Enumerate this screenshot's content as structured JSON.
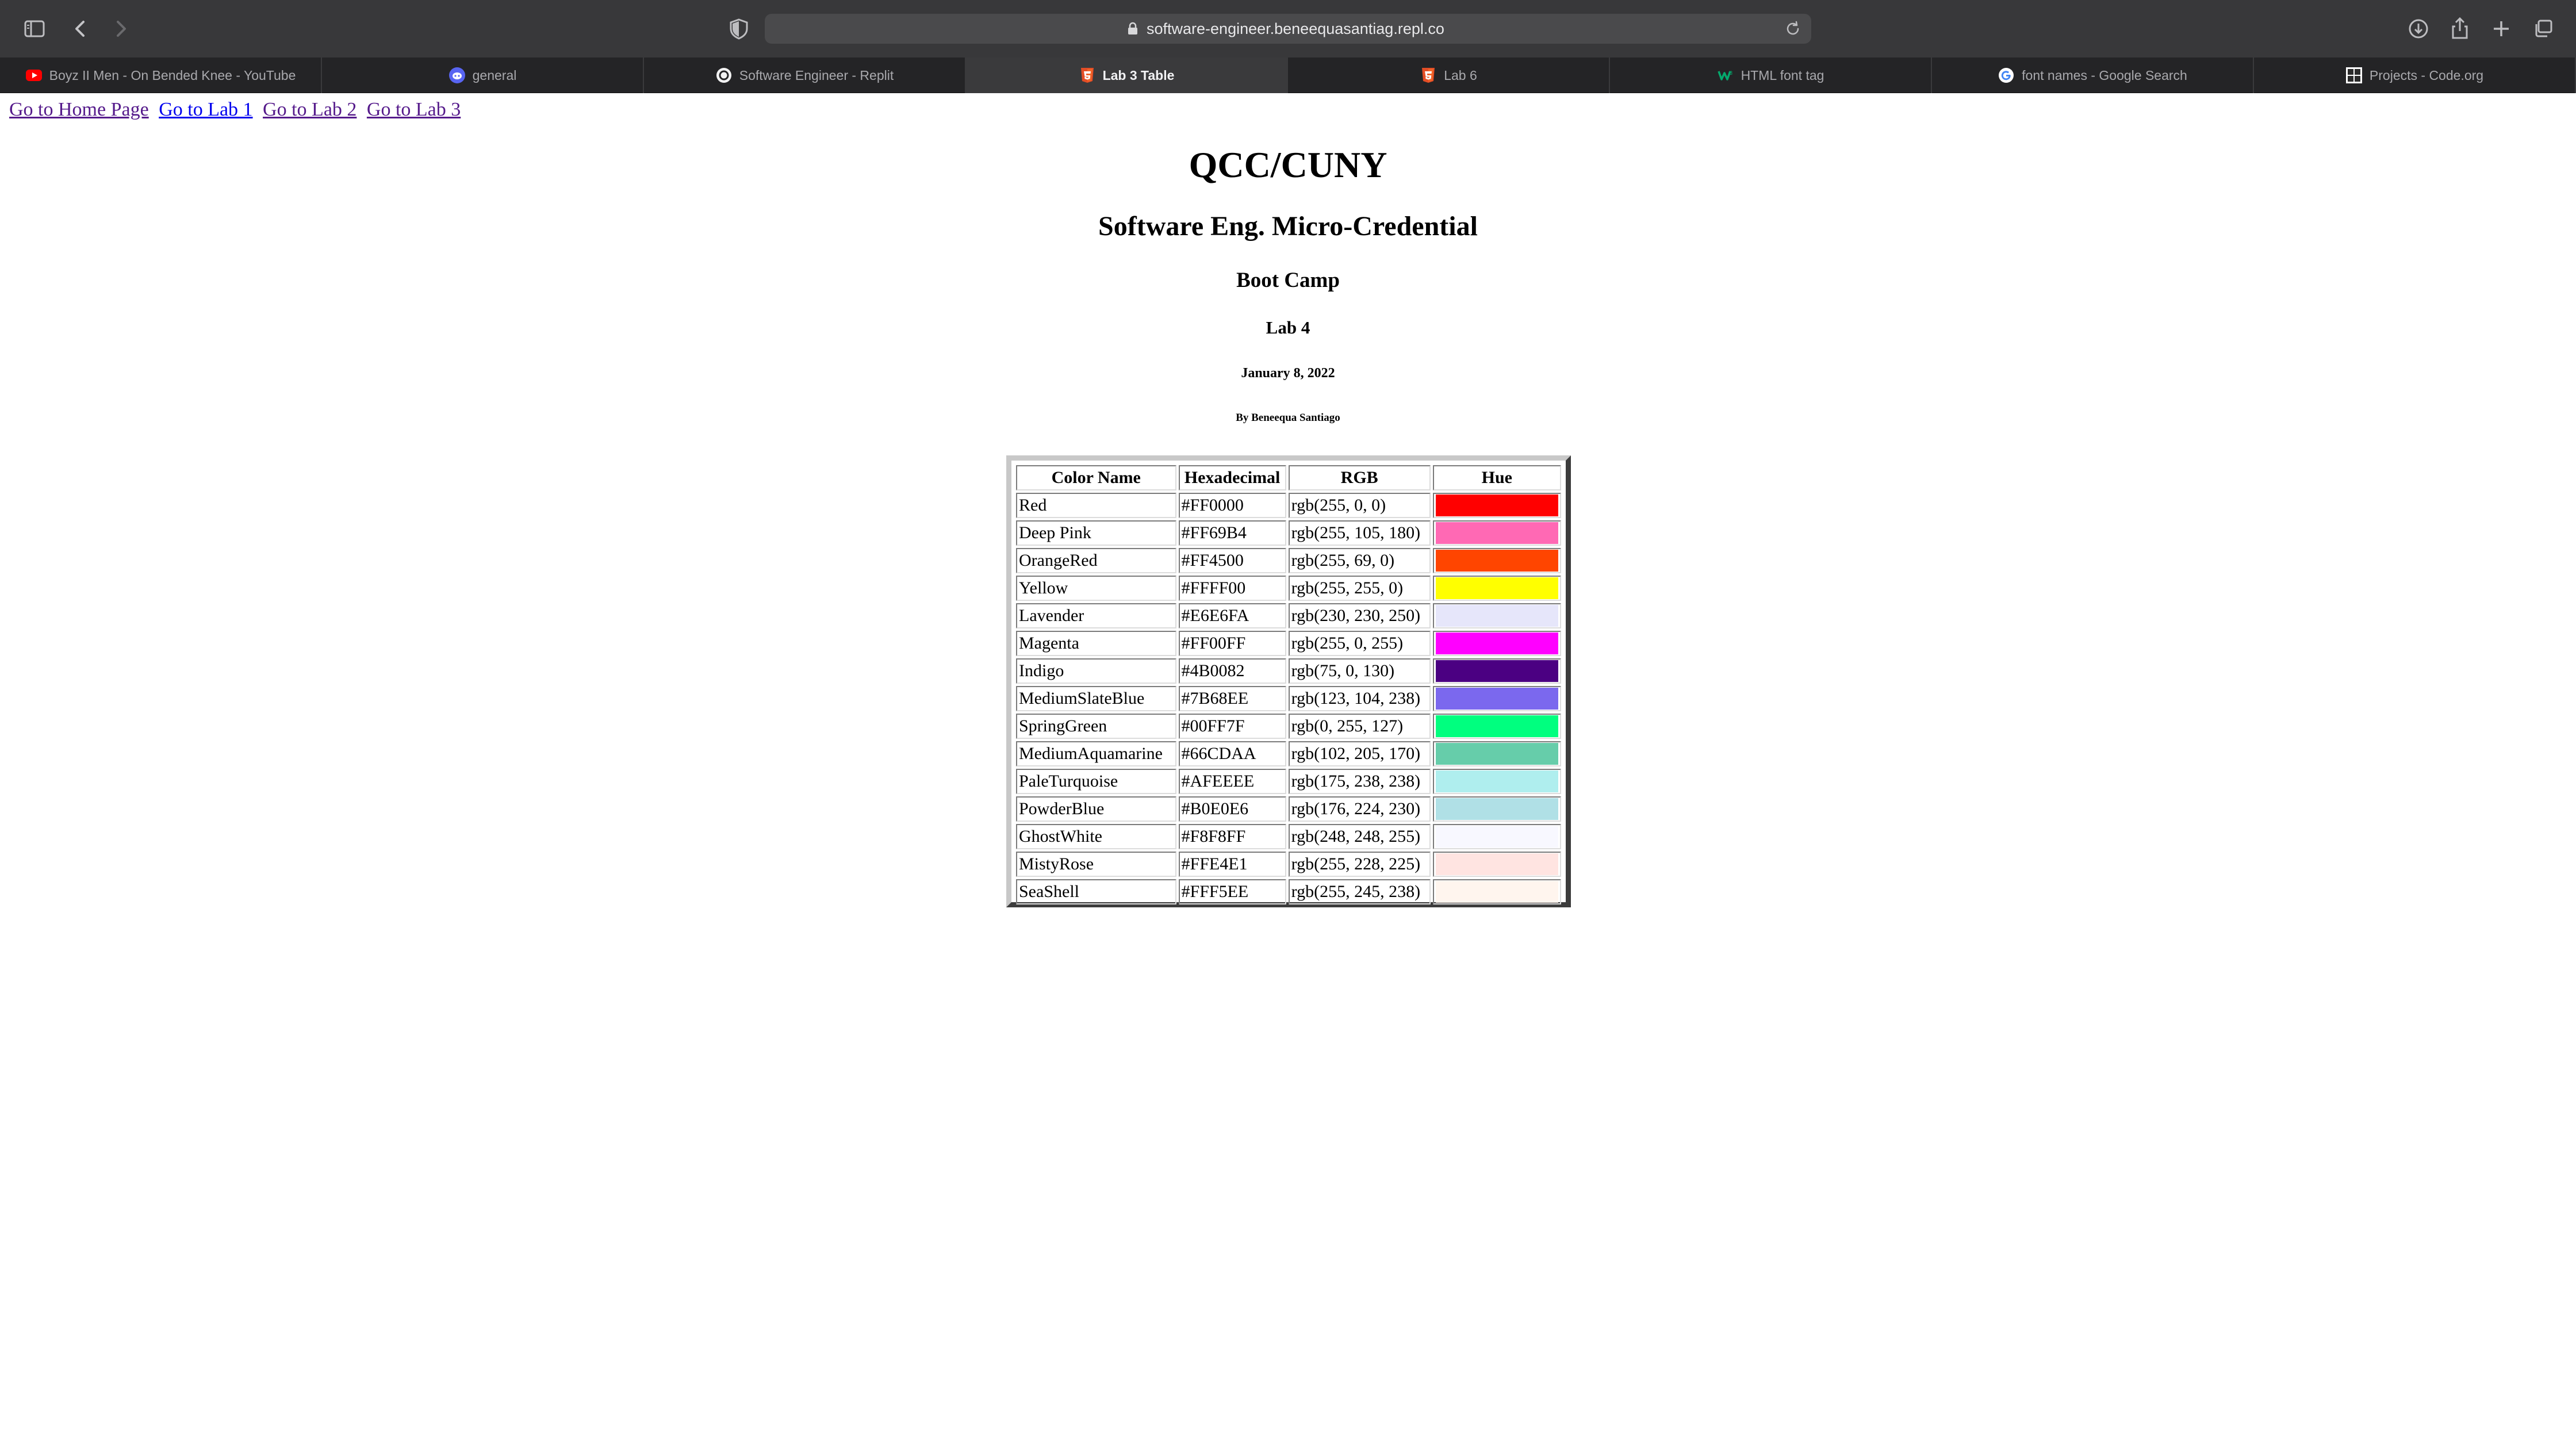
{
  "browser": {
    "url": "software-engineer.beneequasantiag.repl.co",
    "tabs": [
      {
        "label": "Boyz II Men - On Bended Knee - YouTube",
        "icon": "youtube-icon",
        "active": false
      },
      {
        "label": "general",
        "icon": "discord-icon",
        "active": false
      },
      {
        "label": "Software Engineer - Replit",
        "icon": "replit-icon",
        "active": false
      },
      {
        "label": "Lab 3 Table",
        "icon": "html5-icon",
        "active": true
      },
      {
        "label": "Lab 6",
        "icon": "html5-icon",
        "active": false
      },
      {
        "label": "HTML font tag",
        "icon": "w3schools-icon",
        "active": false
      },
      {
        "label": "font names - Google Search",
        "icon": "google-icon",
        "active": false
      },
      {
        "label": "Projects - Code.org",
        "icon": "codeorg-icon",
        "active": false
      }
    ]
  },
  "page": {
    "links": [
      "Go to Home Page",
      "Go to Lab 1",
      "Go to Lab 2",
      "Go to Lab 3"
    ],
    "heading1": "QCC/CUNY",
    "heading2": "Software Eng. Micro-Credential",
    "heading3": "Boot Camp",
    "heading4": "Lab 4",
    "date": "January 8, 2022",
    "author": "By Beneequa Santiago"
  },
  "table": {
    "headers": [
      "Color Name",
      "Hexadecimal",
      "RGB",
      "Hue"
    ],
    "rows": [
      {
        "name": "Red",
        "hex": "#FF0000",
        "rgb": "rgb(255, 0, 0)",
        "color": "#FF0000"
      },
      {
        "name": "Deep Pink",
        "hex": "#FF69B4",
        "rgb": "rgb(255, 105, 180)",
        "color": "#FF69B4"
      },
      {
        "name": "OrangeRed",
        "hex": "#FF4500",
        "rgb": "rgb(255, 69, 0)",
        "color": "#FF4500"
      },
      {
        "name": "Yellow",
        "hex": "#FFFF00",
        "rgb": "rgb(255, 255, 0)",
        "color": "#FFFF00"
      },
      {
        "name": "Lavender",
        "hex": "#E6E6FA",
        "rgb": "rgb(230, 230, 250)",
        "color": "#E6E6FA"
      },
      {
        "name": "Magenta",
        "hex": "#FF00FF",
        "rgb": "rgb(255, 0, 255)",
        "color": "#FF00FF"
      },
      {
        "name": "Indigo",
        "hex": "#4B0082",
        "rgb": "rgb(75, 0, 130)",
        "color": "#4B0082"
      },
      {
        "name": "MediumSlateBlue",
        "hex": "#7B68EE",
        "rgb": "rgb(123, 104, 238)",
        "color": "#7B68EE"
      },
      {
        "name": "SpringGreen",
        "hex": "#00FF7F",
        "rgb": "rgb(0, 255, 127)",
        "color": "#00FF7F"
      },
      {
        "name": "MediumAquamarine",
        "hex": "#66CDAA",
        "rgb": "rgb(102, 205, 170)",
        "color": "#66CDAA"
      },
      {
        "name": "PaleTurquoise",
        "hex": "#AFEEEE",
        "rgb": "rgb(175, 238, 238)",
        "color": "#AFEEEE"
      },
      {
        "name": "PowderBlue",
        "hex": "#B0E0E6",
        "rgb": "rgb(176, 224, 230)",
        "color": "#B0E0E6"
      },
      {
        "name": "GhostWhite",
        "hex": "#F8F8FF",
        "rgb": "rgb(248, 248, 255)",
        "color": "#F8F8FF"
      },
      {
        "name": "MistyRose",
        "hex": "#FFE4E1",
        "rgb": "rgb(255, 228, 225)",
        "color": "#FFE4E1"
      },
      {
        "name": "SeaShell",
        "hex": "#FFF5EE",
        "rgb": "rgb(255, 245, 238)",
        "color": "#FFF5EE"
      }
    ]
  }
}
